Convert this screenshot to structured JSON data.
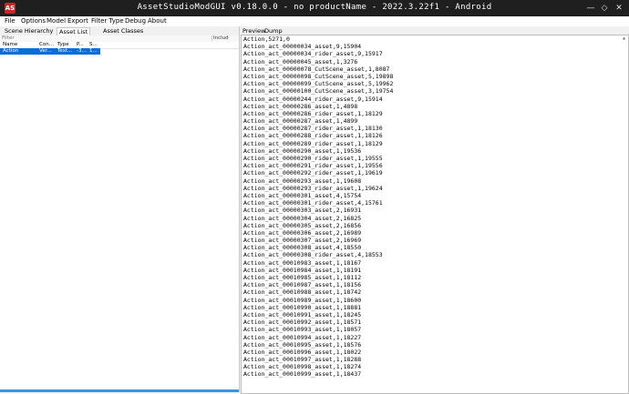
{
  "titlebar": {
    "logo": "AS",
    "title": "AssetStudioModGUI v0.18.0.0 - no productName - 2022.3.22f1 - Android",
    "minimize_icon": "—",
    "maximize_icon": "◇",
    "close_icon": "✕"
  },
  "menu": [
    "File",
    "Options",
    "Model",
    "Export",
    "Filter Type",
    "Debug",
    "About"
  ],
  "left": {
    "tabs": [
      "Scene Hierarchy",
      "Asset List",
      "Asset Classes"
    ],
    "filter_placeholder": "Filter",
    "filter_select": "Includ",
    "columns": [
      "Name",
      "Con...",
      "Type",
      "P...",
      "S..."
    ],
    "row": [
      "Action",
      "Ver...",
      "Text...",
      "-3...",
      "1..."
    ]
  },
  "right": {
    "tabs": [
      "Preview",
      "Dump"
    ],
    "dump_lines": [
      "Action,5271,0",
      "Action_act_00000034_asset,9,15904",
      "Action_act_00000034_rider_asset,9,15917",
      "Action_act_00000045_asset,1,3276",
      "Action_act_00000078_CutScene_asset,1,8087",
      "Action_act_00000098_CutScene_asset,5,19898",
      "Action_act_00000099_CutScene_asset,5,19962",
      "Action_act_00000100_CutScene_asset,3,19754",
      "Action_act_00000244_rider_asset,9,15914",
      "Action_act_00000286_asset,1,4898",
      "Action_act_00000286_rider_asset,1,18129",
      "Action_act_00000287_asset,1,4899",
      "Action_act_00000287_rider_asset,1,18130",
      "Action_act_00000288_rider_asset,1,18126",
      "Action_act_00000289_rider_asset,1,18129",
      "Action_act_00000290_asset,1,19536",
      "Action_act_00000290_rider_asset,1,19555",
      "Action_act_00000291_rider_asset,1,19556",
      "Action_act_00000292_rider_asset,1,19619",
      "Action_act_00000293_asset,1,19608",
      "Action_act_00000293_rider_asset,1,19624",
      "Action_act_00000301_asset,4,15754",
      "Action_act_00000301_rider_asset,4,15761",
      "Action_act_00000303_asset,2,16931",
      "Action_act_00000304_asset,2,16825",
      "Action_act_00000305_asset,2,16856",
      "Action_act_00000306_asset,2,16989",
      "Action_act_00000307_asset,2,16969",
      "Action_act_00000308_asset,4,18550",
      "Action_act_00000308_rider_asset,4,18553",
      "Action_act_00010983_asset,1,18167",
      "Action_act_00010984_asset,1,18191",
      "Action_act_00010985_asset,1,18112",
      "Action_act_00010987_asset,1,18156",
      "Action_act_00010988_asset,1,18742",
      "Action_act_00010989_asset,1,18600",
      "Action_act_00010990_asset,1,18881",
      "Action_act_00010991_asset,1,18245",
      "Action_act_00010992_asset,1,18571",
      "Action_act_00010993_asset,1,18057",
      "Action_act_00010994_asset,1,18227",
      "Action_act_00010995_asset,1,18576",
      "Action_act_00010996_asset,1,18022",
      "Action_act_00010997_asset,1,18288",
      "Action_act_00010998_asset,1,18274",
      "Action_act_00010999_asset,1,18437"
    ]
  },
  "colors": {
    "titlebar": "#1f1f1f",
    "selection": "#0a6cd6",
    "progress": "#3a96dd",
    "logo": "#c62828"
  }
}
